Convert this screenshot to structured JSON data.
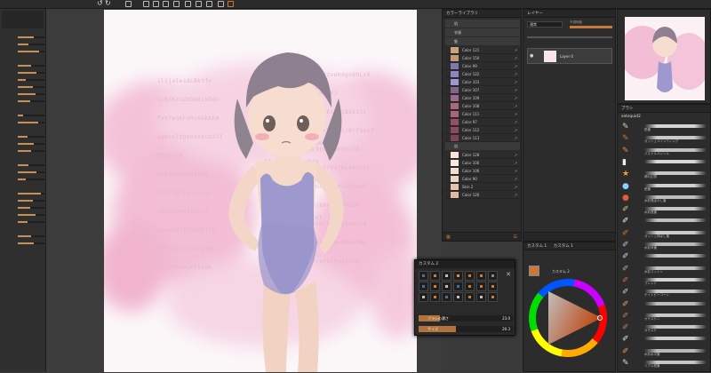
{
  "topbar": {
    "icons": [
      "undo-icon",
      "redo-icon",
      "transform-icon",
      "layer-op-icon",
      "layer-op-icon",
      "layer-op-icon",
      "layer-op-icon",
      "layer-op-icon",
      "layer-op-icon",
      "layer-op-icon",
      "layer-op-icon",
      "layer-op-icon"
    ]
  },
  "canvas": {
    "bg_text_lines": [
      "aqshtzvehdgnGhLxX",
      "ilijalesdLBkYfn",
      "agWtxltQmGXnbcU2",
      "1f5MKEKJ",
      "1CBhKzuZKDNBLHDdv",
      "ZKaRdkLJ",
      " 3kcdu6tHoiBXXSSi",
      "fVkTeq6FqRvmGbKkm",
      "RTSX4dbe4F6F2PDP",
      "FNxxrZO7ki/BrFQkoZ",
      "agWtxltQmGXnbcU21f",
      "xNiuuZGYATAE05bekK",
      "OL9EQQBUoOn2iB",
      "KEg/hBd",
      "IBcLZbsCLBhmNdq",
      "UqP2YrYxjbLAKHZFb",
      "LeZYbSOW6Ikyw3",
      "ExGEVdFfyH2VtQ",
      "j8Gn+nE1PJbbYxxM",
      "FfE7TgrTqzr4v2L",
      "W4vR8iXxNeyCYg",
      "xmjB6ebHL0OcsQ",
      "2KKxkD4N3Zdxj2",
      "X2zxitbOlEHN9XoI",
      "lutGFbkSboseAn/B",
      "oowdSqTfS2WXRTVE",
      "IRNYdTkYafyN+",
      "lCo3jAxmoWN0u8Ne",
      "s2xZgchnCsGrQTBL",
      "z8TmsxhqPYbEHgI",
      "F0ceFOtKwYtn8e",
      "idq/Rq4VCmFkO9k"
    ]
  },
  "color_library": {
    "title": "カラーライブラリ",
    "folders": [
      "肌",
      "衣服",
      "髪"
    ],
    "colors": [
      {
        "name": "Color 121",
        "hex": "#c9a27a"
      },
      {
        "name": "Color 150",
        "hex": "#c29a74"
      },
      {
        "name": "Color 99",
        "hex": "#7f76b4"
      },
      {
        "name": "Color 122",
        "hex": "#8c86c2"
      },
      {
        "name": "Color 103",
        "hex": "#9e98cc"
      },
      {
        "name": "Color 107",
        "hex": "#84638c"
      },
      {
        "name": "Color 109",
        "hex": "#956c8a"
      },
      {
        "name": "Color 108",
        "hex": "#a76a7d"
      },
      {
        "name": "Color 111",
        "hex": "#a56676"
      },
      {
        "name": "Color 97",
        "hex": "#984f63"
      },
      {
        "name": "Color 112",
        "hex": "#8a4b5a"
      },
      {
        "name": "Color 113",
        "hex": "#7d4554"
      }
    ],
    "folder2": "肌",
    "colors2": [
      {
        "name": "Color 128",
        "hex": "#f6e3d9"
      },
      {
        "name": "Color 106",
        "hex": "#f7e7df"
      },
      {
        "name": "Color 106",
        "hex": "#f1ddd2"
      },
      {
        "name": "Color 90",
        "hex": "#eed4c6"
      },
      {
        "name": "Skin 2",
        "hex": "#e8c2a8"
      },
      {
        "name": "Color 126",
        "hex": "#e3b8a0"
      }
    ]
  },
  "layer_panel": {
    "title": "レイヤー",
    "blend_mode": "通常",
    "opacity_label": "不透明度",
    "layer_name": "Layer 0"
  },
  "custom1": {
    "tab1": "カスタム 1",
    "tab2": "カスタム 1",
    "subtitle": "カスタム 2"
  },
  "custom2": {
    "title": "カスタム 2",
    "slider1_label": "ブラシの濃さ",
    "slider1_value": "23.0",
    "slider1_fill": 0.23,
    "slider2_label": "サイズ",
    "slider2_value": "20.3",
    "slider2_fill": 0.4
  },
  "brush_panel": {
    "title": "ブラシ",
    "set_name": "setsquid2",
    "brushes": [
      {
        "name": "鉛筆",
        "icon": "pencil-icon",
        "color": "#d4d4d4"
      },
      {
        "name": "ガッシュペインティング",
        "icon": "gouache-brush-icon",
        "color": "#c9c9c9"
      },
      {
        "name": "パステルペンシル",
        "icon": "pastel-icon",
        "color": "#c0c0c0"
      },
      {
        "name": "",
        "icon": "eraser-icon",
        "color": "#d8d8d8"
      },
      {
        "name": "晴れ幻想",
        "icon": "star-icon",
        "color": "#c6c6c6"
      },
      {
        "name": "鉛筆",
        "icon": "drop-icon",
        "color": "#d0d0d0"
      },
      {
        "name": "水彩長ぼかし筆",
        "icon": "drop-icon",
        "color": "#bdbdbd"
      },
      {
        "name": "水彩長筆",
        "icon": "brush-icon",
        "color": "#c8c8c8"
      },
      {
        "name": "",
        "icon": "brush-icon",
        "color": "#bfbfbf"
      },
      {
        "name": "ガッシュ伸ばし筆",
        "icon": "brush-icon",
        "color": "#cbcbcb"
      },
      {
        "name": "水彩滲筆",
        "icon": "brush-icon",
        "color": "#b8b8b8"
      },
      {
        "name": "",
        "icon": "brush-icon",
        "color": "#c4c4c4"
      },
      {
        "name": "水彩コットン",
        "icon": "brush-icon",
        "color": "#c1c1c1"
      },
      {
        "name": "ブレンド",
        "icon": "brush-icon",
        "color": "#d3d3d3"
      },
      {
        "name": "ケイトピーコーン",
        "icon": "brush-icon",
        "color": "#c7c7c7"
      },
      {
        "name": "",
        "icon": "brush-icon",
        "color": "#bcbcbc"
      },
      {
        "name": "カサスケニ",
        "icon": "brush-icon",
        "color": "#c9c9c9"
      },
      {
        "name": "カサスケ",
        "icon": "brush-icon",
        "color": "#c6c6c6"
      },
      {
        "name": "",
        "icon": "brush-icon",
        "color": "#cfcfcf"
      },
      {
        "name": "水彩水平筆",
        "icon": "brush-icon",
        "color": "#b9b9b9"
      },
      {
        "name": "リアル鉛筆",
        "icon": "pencil-icon",
        "color": "#c5c5c5"
      }
    ]
  },
  "accent": "#c9773a"
}
